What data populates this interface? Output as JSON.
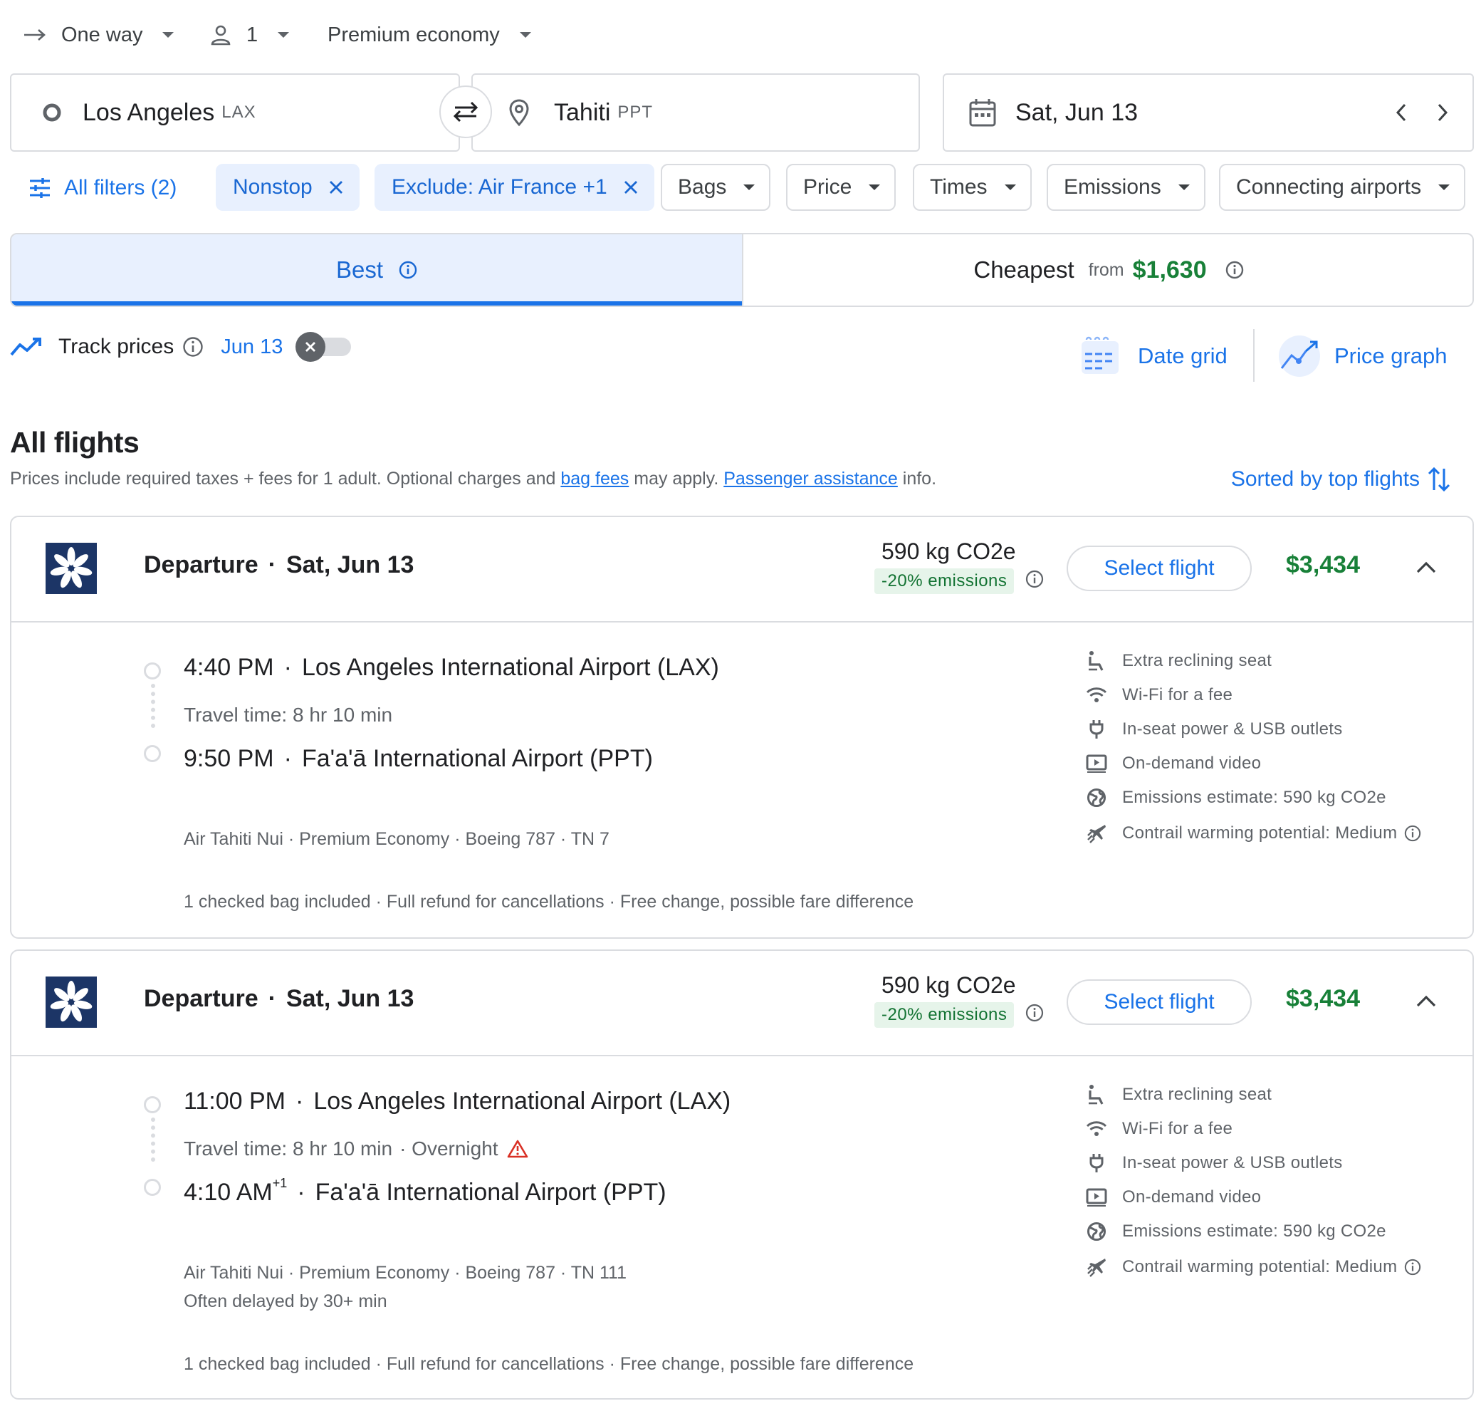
{
  "search": {
    "trip_type": "One way",
    "passengers": "1",
    "cabin": "Premium economy",
    "origin": {
      "name": "Los Angeles",
      "code": "LAX"
    },
    "destination": {
      "name": "Tahiti",
      "code": "PPT"
    },
    "date": "Sat, Jun 13"
  },
  "filters": {
    "all_filters": "All filters (2)",
    "chips_active": [
      "Nonstop",
      "Exclude: Air France +1"
    ],
    "chips_dropdown": [
      "Bags",
      "Price",
      "Times",
      "Emissions",
      "Connecting airports"
    ]
  },
  "tabs": {
    "best": "Best",
    "cheapest": "Cheapest",
    "from": "from",
    "cheapest_price": "$1,630"
  },
  "track": {
    "label": "Track prices",
    "date": "Jun 13",
    "date_grid": "Date grid",
    "price_graph": "Price graph"
  },
  "results": {
    "title": "All flights",
    "subtitle_pre": "Prices include required taxes + fees for 1 adult. Optional charges and ",
    "bag_fees_link": "bag fees",
    "subtitle_mid": " may apply. ",
    "assistance_link": "Passenger assistance",
    "subtitle_post": " info.",
    "sort_label": "Sorted by top flights"
  },
  "flights": [
    {
      "departure_label": "Departure",
      "date": "Sat, Jun 13",
      "co2": "590 kg CO2e",
      "emissions_badge": "-20% emissions",
      "select_label": "Select flight",
      "price": "$3,434",
      "dep_time": "4:40 PM",
      "dep_suffix": "",
      "dep_airport": "Los Angeles International Airport (LAX)",
      "travel_time": "Travel time: 8 hr 10 min",
      "overnight": "",
      "arr_time": "9:50 PM",
      "arr_suffix": "",
      "arr_airport": "Fa'a'ā International Airport (PPT)",
      "details": "Air Tahiti Nui · Premium Economy · Boeing 787 · TN 7",
      "delay_note": "",
      "fare": "1 checked bag included · Full refund for cancellations · Free change, possible fare difference",
      "amenities": [
        {
          "icon": "seat-icon",
          "label": "Extra reclining seat"
        },
        {
          "icon": "wifi-icon",
          "label": "Wi-Fi for a fee"
        },
        {
          "icon": "power-plug-icon",
          "label": "In-seat power & USB outlets"
        },
        {
          "icon": "video-icon",
          "label": "On-demand video"
        },
        {
          "icon": "globe-icon",
          "label": "Emissions estimate: 590 kg CO2e"
        },
        {
          "icon": "contrail-icon",
          "label": "Contrail warming potential: Medium"
        }
      ]
    },
    {
      "departure_label": "Departure",
      "date": "Sat, Jun 13",
      "co2": "590 kg CO2e",
      "emissions_badge": "-20% emissions",
      "select_label": "Select flight",
      "price": "$3,434",
      "dep_time": "11:00 PM",
      "dep_suffix": "",
      "dep_airport": "Los Angeles International Airport (LAX)",
      "travel_time": "Travel time: 8 hr 10 min",
      "overnight": "· Overnight",
      "arr_time": "4:10 AM",
      "arr_suffix": "+1",
      "arr_airport": "Fa'a'ā International Airport (PPT)",
      "details": "Air Tahiti Nui · Premium Economy · Boeing 787 · TN 111",
      "delay_note": "Often delayed by 30+ min",
      "fare": "1 checked bag included · Full refund for cancellations · Free change, possible fare difference",
      "amenities": [
        {
          "icon": "seat-icon",
          "label": "Extra reclining seat"
        },
        {
          "icon": "wifi-icon",
          "label": "Wi-Fi for a fee"
        },
        {
          "icon": "power-plug-icon",
          "label": "In-seat power & USB outlets"
        },
        {
          "icon": "video-icon",
          "label": "On-demand video"
        },
        {
          "icon": "globe-icon",
          "label": "Emissions estimate: 590 kg CO2e"
        },
        {
          "icon": "contrail-icon",
          "label": "Contrail warming potential: Medium"
        }
      ]
    }
  ],
  "colors": {
    "accent_blue": "#1a73e8",
    "price_green": "#188038",
    "chip_active_bg": "#e8f0fe",
    "logo_navy": "#1c3566",
    "warning_red": "#d93025"
  }
}
